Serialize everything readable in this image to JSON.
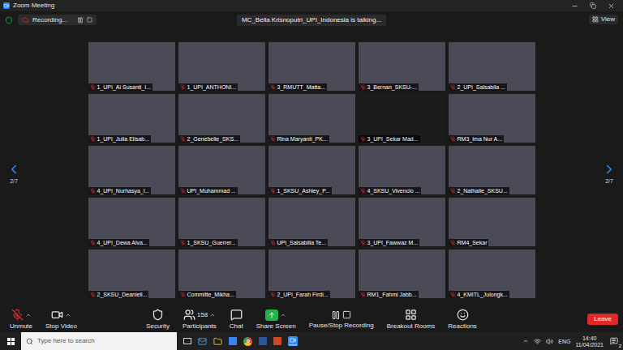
{
  "window": {
    "title": "Zoom Meeting"
  },
  "recording": {
    "label": "Recording..."
  },
  "talking": {
    "text": "MC_Bella Krisnoputri_UPI_Indonesia is talking..."
  },
  "view_button": {
    "label": "View"
  },
  "pager": {
    "left": "2/7",
    "right": "2/7"
  },
  "participants": [
    {
      "name": "1_UPI_Ai Susanti_I...",
      "muted": true,
      "video": true
    },
    {
      "name": "1_UPI_ANTHONI...",
      "muted": true,
      "video": true
    },
    {
      "name": "3_RMUTT_Matta...",
      "muted": true,
      "video": true
    },
    {
      "name": "3_Bernan_SKSU-...",
      "muted": true,
      "video": true
    },
    {
      "name": "2_UPI_Salsabila ...",
      "muted": true,
      "video": true
    },
    {
      "name": "1_UPI_Julia Elisab...",
      "muted": true,
      "video": true
    },
    {
      "name": "2_Genebelle_SKS...",
      "muted": true,
      "video": true
    },
    {
      "name": "Rina Maryanti_PK...",
      "muted": true,
      "video": true
    },
    {
      "name": "3_UPI_Sekar Mad...",
      "muted": true,
      "video": false
    },
    {
      "name": "RM3_Ima Nur A...",
      "muted": true,
      "video": true
    },
    {
      "name": "4_UPI_Nurhasya_I...",
      "muted": true,
      "video": true
    },
    {
      "name": "UPI_Muhammad ...",
      "muted": true,
      "video": true
    },
    {
      "name": "1_SKSU_Ashley_P...",
      "muted": true,
      "video": true
    },
    {
      "name": "4_SKSU_Vivencio ...",
      "muted": true,
      "video": true
    },
    {
      "name": "2_Nathalie_SKSU...",
      "muted": true,
      "video": true
    },
    {
      "name": "4_UPI_Dewa Alva...",
      "muted": true,
      "video": true
    },
    {
      "name": "1_SKSU_Guerrer...",
      "muted": true,
      "video": true
    },
    {
      "name": "UPI_Salsabilla Te...",
      "muted": true,
      "video": true
    },
    {
      "name": "3_UPI_Fawwaz M...",
      "muted": true,
      "video": true
    },
    {
      "name": "RM4_Sekar",
      "muted": true,
      "video": true
    },
    {
      "name": "2_SKSU_Deaniell...",
      "muted": true,
      "video": true
    },
    {
      "name": "Committe_Mikha...",
      "muted": true,
      "video": true
    },
    {
      "name": "2_UPI_Farah Firdi...",
      "muted": true,
      "video": true
    },
    {
      "name": "RM1_Fahmi Jabb...",
      "muted": true,
      "video": true
    },
    {
      "name": "4_KMITL_Julongk...",
      "muted": true,
      "video": true
    }
  ],
  "toolbar": {
    "left": [
      {
        "label": "Unmute",
        "kind": "audio",
        "has_menu": true
      },
      {
        "label": "Stop Video",
        "kind": "video",
        "has_menu": true
      }
    ],
    "center": [
      {
        "label": "Security",
        "kind": "security",
        "has_menu": false
      },
      {
        "label": "Participants",
        "kind": "participants",
        "has_menu": true,
        "count": "158"
      },
      {
        "label": "Chat",
        "kind": "chat",
        "has_menu": false
      },
      {
        "label": "Share Screen",
        "kind": "share",
        "has_menu": true
      },
      {
        "label": "Pause/Stop Recording",
        "kind": "record",
        "has_menu": false
      },
      {
        "label": "Breakout Rooms",
        "kind": "breakout",
        "has_menu": false
      },
      {
        "label": "Reactions",
        "kind": "reactions",
        "has_menu": false
      }
    ],
    "leave": "Leave"
  },
  "taskbar": {
    "search_placeholder": "Type here to search",
    "language": "ENG",
    "time": "14:40",
    "date": "11/04/2021",
    "notifications": "2"
  }
}
